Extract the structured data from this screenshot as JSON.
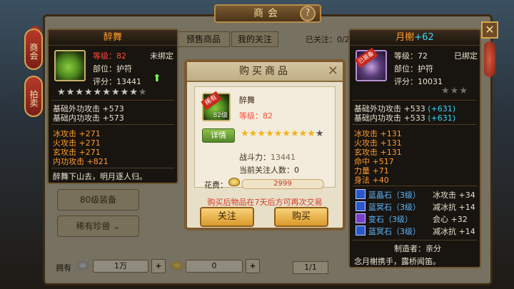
{
  "shop": {
    "title": "商会",
    "help": "?",
    "close": "✕",
    "side_tabs": [
      "商会",
      "拍卖"
    ],
    "tabs": [
      "预售商品",
      "我的关注"
    ],
    "followed": "已关注：0/20",
    "left_buttons": [
      "80级装备",
      "稀有珍兽"
    ],
    "bottom": {
      "have_label": "拥有",
      "silver": "1万",
      "gold": "0",
      "page": "1/1"
    }
  },
  "left_card": {
    "name": "醉舞",
    "level_label": "等级：",
    "level": "82",
    "bind": "未绑定",
    "slot": "部位：护符",
    "score_label": "评分：",
    "score": "13441",
    "stars_on": 9,
    "stars_total": 10,
    "base_stats": [
      "基础外功攻击 +573",
      "基础内功攻击 +573"
    ],
    "attr_stats": [
      "冰攻击 +271",
      "火攻击 +271",
      "玄攻击 +271",
      "内功攻击 +821"
    ],
    "desc": "醉舞下山去，明月逐人归。"
  },
  "right_card": {
    "name": "月榭",
    "enhance": "+62",
    "badge": "已装备",
    "level": "等级：72",
    "bind": "已绑定",
    "slot": "部位：护符",
    "score": "评分：10031",
    "stars_on": 0,
    "stars_total": 3,
    "base_stats": [
      {
        "text": "基础外功攻击 +533",
        "bonus": "(+631)"
      },
      {
        "text": "基础内功攻击 +533",
        "bonus": "(+631)"
      }
    ],
    "attr_stats": [
      "冰攻击 +131",
      "火攻击 +131",
      "玄攻击 +131",
      "命中 +517",
      "力量 +71",
      "身法 +40"
    ],
    "gems": [
      {
        "name": "蓝晶石（3级）",
        "effect": "冰攻击 +34",
        "color": "#2a58c8"
      },
      {
        "name": "蓝冥石（3级）",
        "effect": "减冰抗 +14",
        "color": "#2a58c8"
      },
      {
        "name": "变石（3级）",
        "effect": "会心 +32",
        "color": "#7a3fc6"
      },
      {
        "name": "蓝冥石（3级）",
        "effect": "减冰抗 +14",
        "color": "#2a58c8"
      }
    ],
    "maker": "制造者：亲分",
    "desc": "念月榭携手，露桥闻笛。"
  },
  "dialog": {
    "title": "购买商品",
    "close": "✕",
    "item_name": "醉舞",
    "rare": "稀有",
    "item_level_tag": "82级",
    "level_label": "等级：",
    "level": "82",
    "detail_button": "详情",
    "stars_on": 9,
    "stars_total": 10,
    "power_label": "战斗力：",
    "power": "13441",
    "watchers_label": "当前关注人数：",
    "watchers": "0",
    "cost_label": "花费：",
    "cost": "2999",
    "notice": "购买后物品在7天后方可再次交易",
    "follow_button": "关注",
    "buy_button": "购买"
  }
}
